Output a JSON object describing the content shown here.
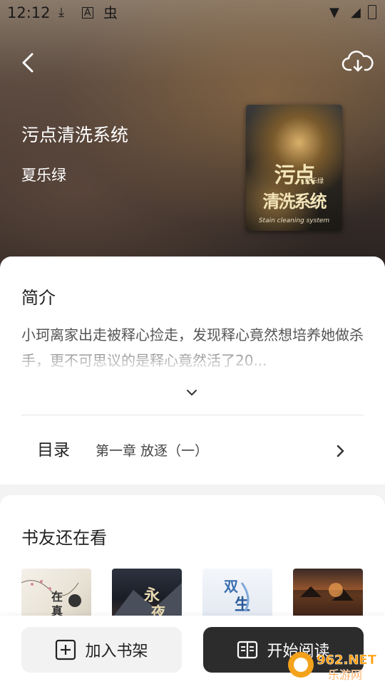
{
  "status_bar": {
    "time": "12:12"
  },
  "header": {
    "back_icon": "chevron-left-icon",
    "download_icon": "cloud-download-icon"
  },
  "book": {
    "title": "污点清洗系统",
    "author": "夏乐绿",
    "cover": {
      "title_line1": "污点",
      "title_line2": "清洗系统",
      "author": "夏乐绿",
      "subtitle": "Stain cleaning system"
    }
  },
  "intro": {
    "heading": "简介",
    "text": "小珂离家出走被释心捡走，发现释心竟然想培养她做杀手，更不可思议的是释心竟然活了20..."
  },
  "toc": {
    "label": "目录",
    "chapter": "第一章 放逐（一）"
  },
  "recommendations": {
    "heading": "书友还在看"
  },
  "actions": {
    "add_shelf": "加入书架",
    "start_reading": "开始阅读"
  },
  "watermark": {
    "brand": "962.NET",
    "site": "乐游网"
  }
}
